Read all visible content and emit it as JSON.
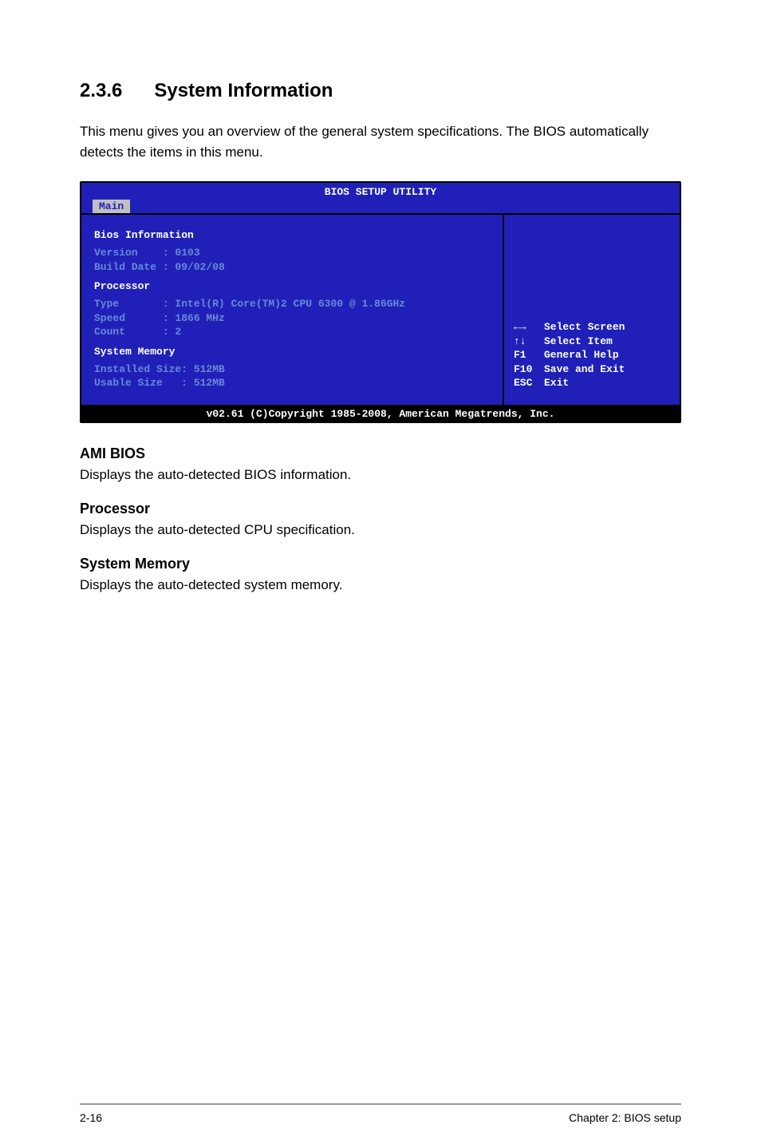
{
  "heading": {
    "number": "2.3.6",
    "title": "System Information"
  },
  "intro": "This menu gives you an overview of the general system specifications. The BIOS automatically detects the items in this menu.",
  "bios": {
    "title": "BIOS SETUP UTILITY",
    "tab": "Main",
    "sections": {
      "bios_info": {
        "label": "Bios Information",
        "version": "Version    : 0103",
        "build_date": "Build Date : 09/02/08"
      },
      "processor": {
        "label": "Processor",
        "type": "Type       : Intel(R) Core(TM)2 CPU 6300 @ 1.86GHz",
        "speed": "Speed      : 1866 MHz",
        "count": "Count      : 2"
      },
      "memory": {
        "label": "System Memory",
        "installed": "Installed Size: 512MB",
        "usable": "Usable Size   : 512MB"
      }
    },
    "side": {
      "select_screen_key": "←→",
      "select_screen": "Select Screen",
      "select_item_key": "↑↓",
      "select_item": "Select Item",
      "help_key": "F1",
      "help": "General Help",
      "save_key": "F10",
      "save": "Save and Exit",
      "exit_key": "ESC",
      "exit": "Exit"
    },
    "footer": "v02.61 (C)Copyright 1985-2008, American Megatrends, Inc."
  },
  "subsections": {
    "ami": {
      "heading": "AMI BIOS",
      "text": "Displays the auto-detected BIOS information."
    },
    "processor": {
      "heading": "Processor",
      "text": "Displays the auto-detected CPU specification."
    },
    "memory": {
      "heading": "System Memory",
      "text": "Displays the auto-detected system memory."
    }
  },
  "page_footer": {
    "left": "2-16",
    "right": "Chapter 2: BIOS setup"
  }
}
